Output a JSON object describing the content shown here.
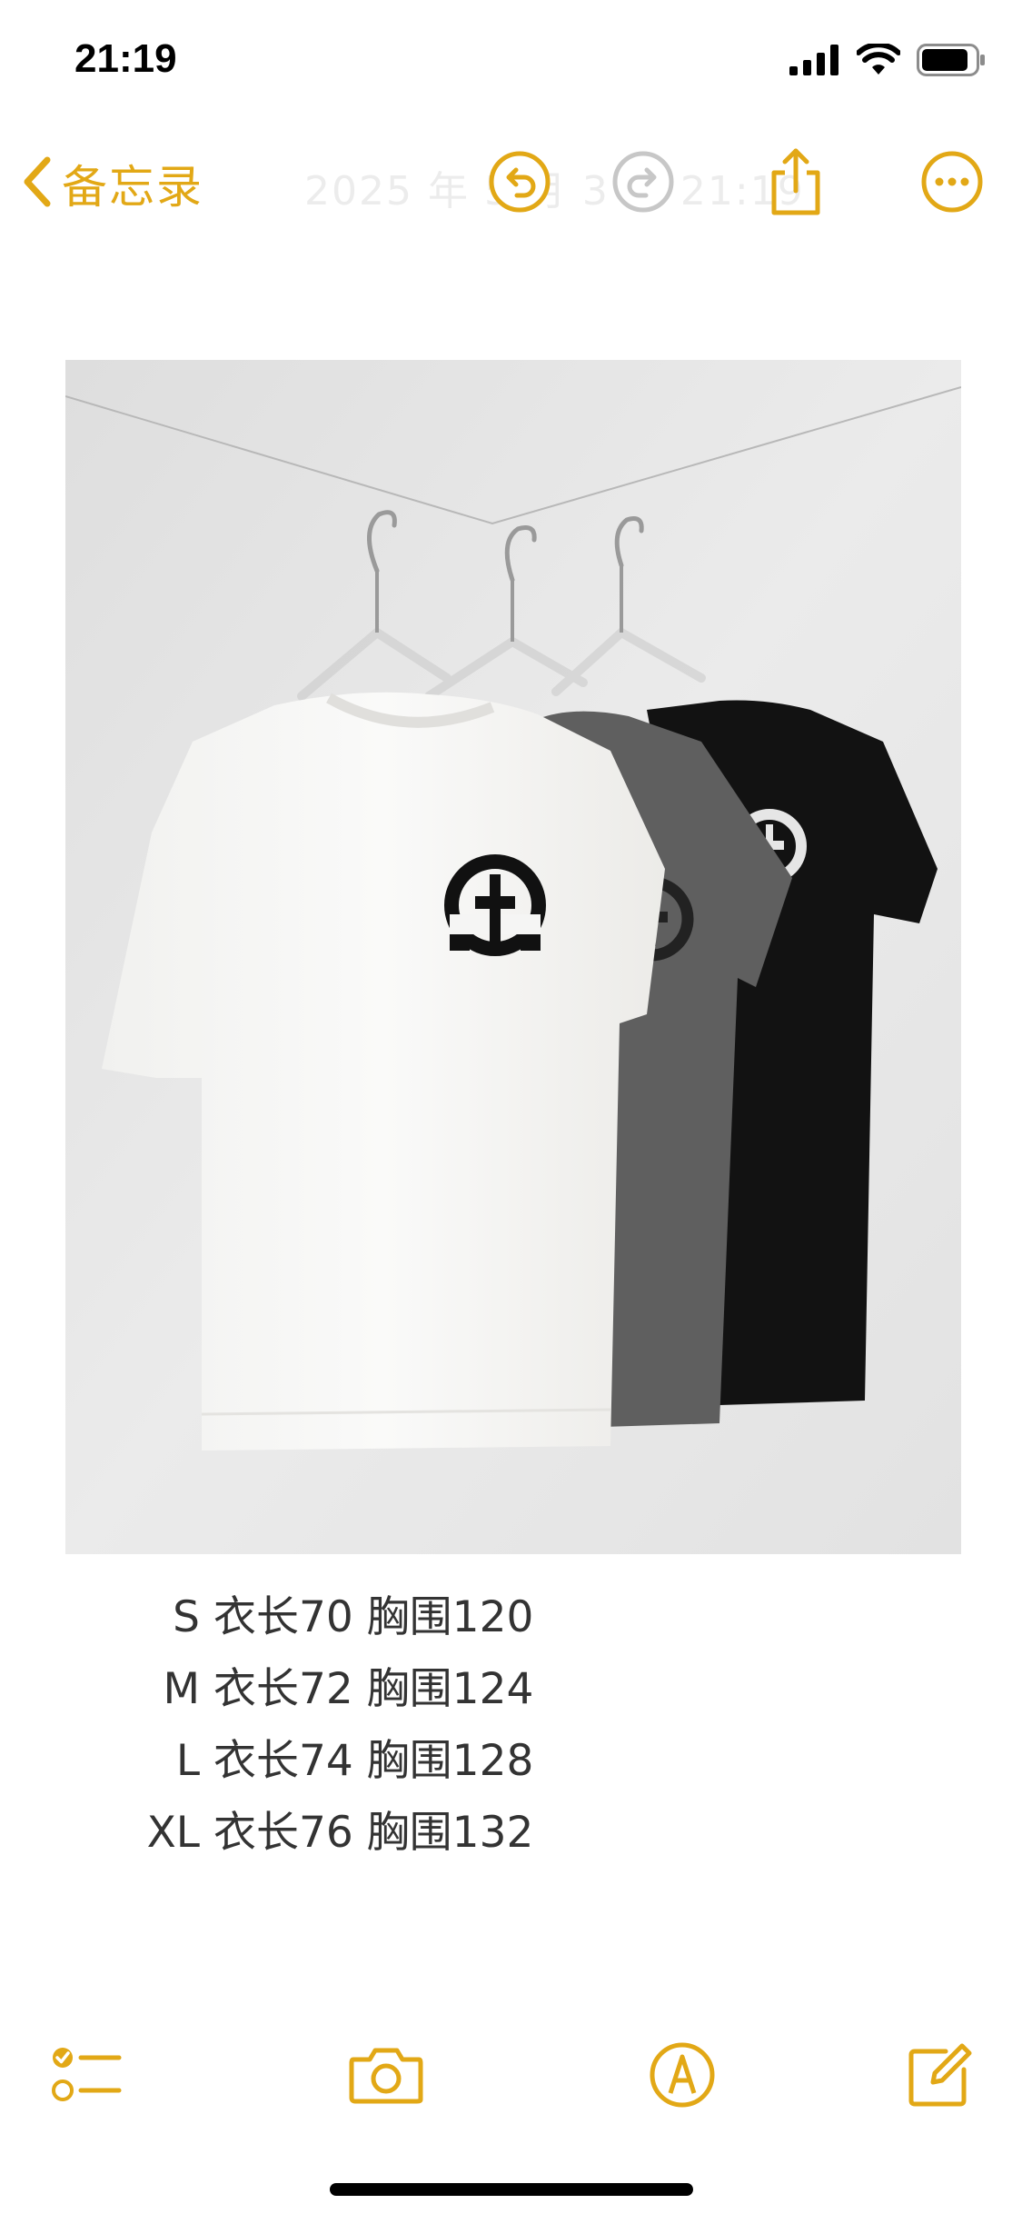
{
  "status_bar": {
    "time": "21:19",
    "icons": [
      "cellular-signal-icon",
      "wifi-icon",
      "battery-icon"
    ]
  },
  "nav": {
    "back_label": "备忘录",
    "title_ghost": "2025 年 5 月 3 日 21:19",
    "buttons": [
      "undo-icon",
      "redo-icon",
      "share-icon",
      "more-icon"
    ]
  },
  "note": {
    "image_description_name": "three-tshirts-photo",
    "sizes": [
      {
        "size": "S",
        "text": " 衣长70 胸围120"
      },
      {
        "size": "M",
        "text": " 衣长72 胸围124"
      },
      {
        "size": "L",
        "text": " 衣长74 胸围128"
      },
      {
        "size": "XL",
        "text": " 衣长76 胸围132"
      }
    ]
  },
  "toolbar": {
    "items": [
      "checklist-icon",
      "camera-icon",
      "markup-icon",
      "compose-icon"
    ]
  },
  "colors": {
    "accent": "#e2a816",
    "text": "#333333",
    "disabled": "#c7c7c7"
  }
}
